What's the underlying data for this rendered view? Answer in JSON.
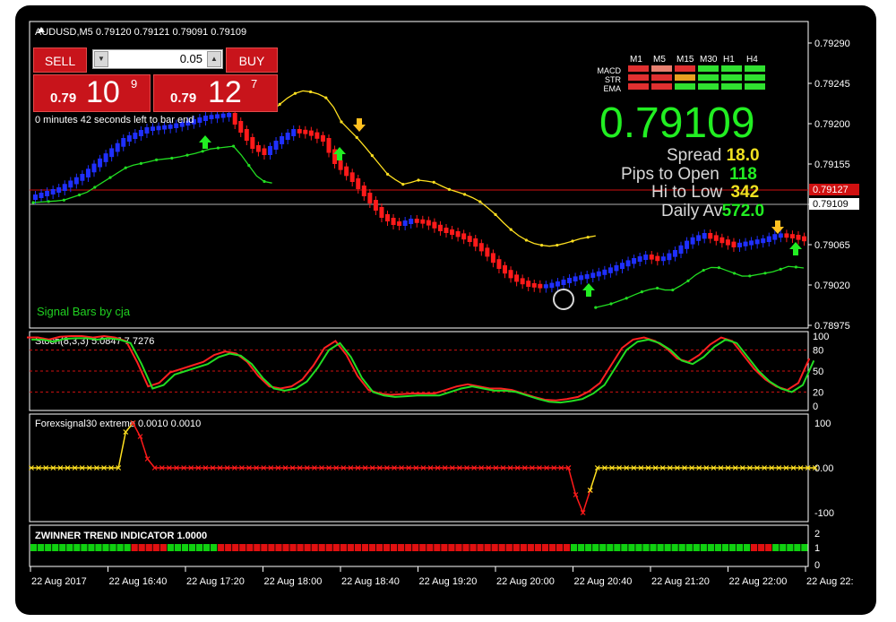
{
  "symbol_header": "AUDUSD,M5  0.79120 0.79121 0.79091 0.79109",
  "trade_panel": {
    "sell_label": "SELL",
    "buy_label": "BUY",
    "lot": "0.05",
    "bid_small": "0.79",
    "bid_big": "10",
    "bid_sup": "9",
    "ask_small": "0.79",
    "ask_big": "12",
    "ask_sup": "7"
  },
  "countdown": "0 minutes 42 seconds left to bar end",
  "signal_credit": "Signal Bars by cja",
  "info_panel": {
    "timeframes": [
      "M1",
      "M5",
      "M15",
      "M30",
      "H1",
      "H4"
    ],
    "indicators": [
      "MACD",
      "STR",
      "EMA"
    ],
    "signal_grid": [
      [
        "#e03030",
        "#e88070",
        "#e03030",
        "#30e030",
        "#30e030",
        "#30e030"
      ],
      [
        "#e03030",
        "#e03030",
        "#e8a020",
        "#30e030",
        "#30e030",
        "#30e030"
      ],
      [
        "#e03030",
        "#e03030",
        "#30e030",
        "#30e030",
        "#30e030",
        "#30e030"
      ]
    ],
    "big_price": "0.79109",
    "spread_label": "Spread",
    "spread_value": "18.0",
    "pips_label": "Pips to Open",
    "pips_value": "118",
    "hilow_label": "Hi to Low",
    "hilow_value": "342",
    "daily_label": "Daily Av",
    "daily_value": "572.0"
  },
  "price_axis": [
    "0.79290",
    "0.79245",
    "0.79200",
    "0.79155",
    "0.79110",
    "0.79065",
    "0.79020",
    "0.78975"
  ],
  "price_tags": {
    "ask": "0.79127",
    "bid": "0.79109"
  },
  "stoch": {
    "title": "Stoch(8,3,3) 5.0847 7.7276",
    "levels": [
      "100",
      "80",
      "50",
      "20",
      "0"
    ]
  },
  "forexsignal": {
    "title": "Forexsignal30 extreme 0.0010 0.0010",
    "levels": [
      "100",
      "0.00",
      "-100"
    ]
  },
  "zwinner": {
    "title": "ZWINNER TREND INDICATOR 1.0000",
    "levels": [
      "2",
      "1",
      "0"
    ]
  },
  "time_axis": [
    "22 Aug 2017",
    "22 Aug 16:40",
    "22 Aug 17:20",
    "22 Aug 18:00",
    "22 Aug 18:40",
    "22 Aug 19:20",
    "22 Aug 20:00",
    "22 Aug 20:40",
    "22 Aug 21:20",
    "22 Aug 22:00",
    "22 Aug 22:"
  ],
  "colors": {
    "bull": "#1f2fff",
    "bear": "#ff1a1a",
    "ma_yellow": "#ffe020",
    "ma_green": "#22dd22",
    "ask_line": "#d01010",
    "bid_line": "#b0b0b0"
  }
}
